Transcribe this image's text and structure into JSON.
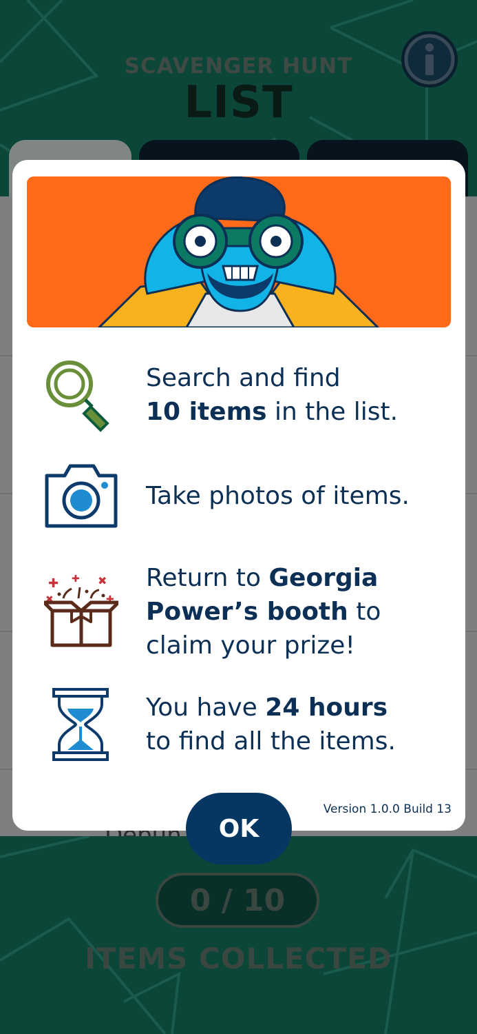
{
  "header": {
    "subtitle": "SCAVENGER HUNT",
    "title": "LIST",
    "info_icon": "info-icon"
  },
  "background": {
    "partial_row_text": "Debun"
  },
  "modal": {
    "rows": [
      {
        "icon": "magnifying-glass-icon",
        "plain": "Search and find",
        "bold": "10 items",
        "after": " in the list."
      },
      {
        "icon": "camera-icon",
        "text": "Take photos of items."
      },
      {
        "icon": "gift-box-icon",
        "before": "Return to ",
        "bold1": "Georgia",
        "bold2": "Power’s booth",
        "after": " to",
        "line3": "claim your prize!"
      },
      {
        "icon": "hourglass-icon",
        "before": "You have ",
        "bold": "24 hours",
        "line2": "to find all the items."
      }
    ],
    "version": "Version 1.0.0 Build 13",
    "ok_label": "OK"
  },
  "footer": {
    "counter": "0 / 10",
    "label": "ITEMS COLLECTED"
  },
  "colors": {
    "navy": "#0b2f55",
    "ok_button": "#063763",
    "hero_orange": "#fd6a19",
    "header_green": "#0b4639",
    "magnifier_green": "#6a8f3a",
    "gift_red": "#c8333b"
  }
}
